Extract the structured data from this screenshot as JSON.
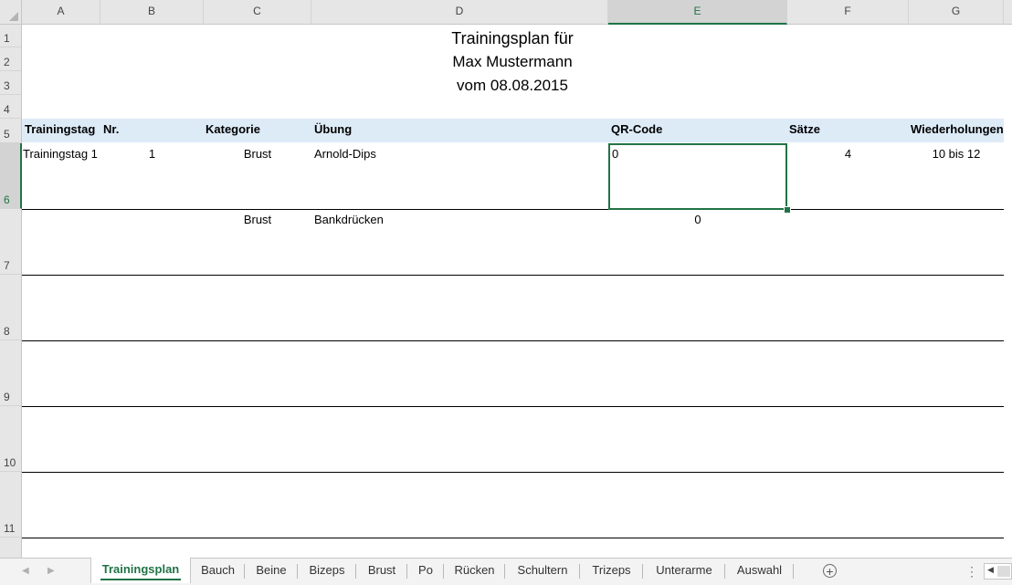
{
  "columns": [
    "A",
    "B",
    "C",
    "D",
    "E",
    "F",
    "G"
  ],
  "rows": [
    "1",
    "2",
    "3",
    "4",
    "5",
    "6",
    "7",
    "8",
    "9",
    "10",
    "11"
  ],
  "title": {
    "line1": "Trainingsplan für",
    "line2": "Max Mustermann",
    "line3": "vom 08.08.2015"
  },
  "table": {
    "headers": {
      "trainingstag": "Trainingstag",
      "nr": "Nr.",
      "kategorie": "Kategorie",
      "uebung": "Übung",
      "qr_code": "QR-Code",
      "saetze": "Sätze",
      "wiederholungen": "Wiederholungen"
    },
    "rows": [
      {
        "trainingstag": "Trainingstag 1",
        "nr": "1",
        "kategorie": "Brust",
        "uebung": "Arnold-Dips",
        "qr_code": "0",
        "saetze": "4",
        "wiederholungen": "10 bis 12"
      },
      {
        "trainingstag": "",
        "nr": "",
        "kategorie": "Brust",
        "uebung": "Bankdrücken",
        "qr_code": "0",
        "saetze": "",
        "wiederholungen": ""
      }
    ]
  },
  "selection": {
    "column": "E",
    "row": "6"
  },
  "sheet_tabs": [
    "Trainingsplan",
    "Bauch",
    "Beine",
    "Bizeps",
    "Brust",
    "Po",
    "Rücken",
    "Schultern",
    "Trizeps",
    "Unterarme",
    "Auswahl"
  ],
  "active_tab": "Trainingsplan",
  "colors": {
    "accent": "#217346",
    "header_band": "#ddebf7"
  },
  "icons": {
    "add_sheet": "plus-circle-icon",
    "nav_prev": "triangle-left-icon",
    "nav_next": "triangle-right-icon"
  }
}
